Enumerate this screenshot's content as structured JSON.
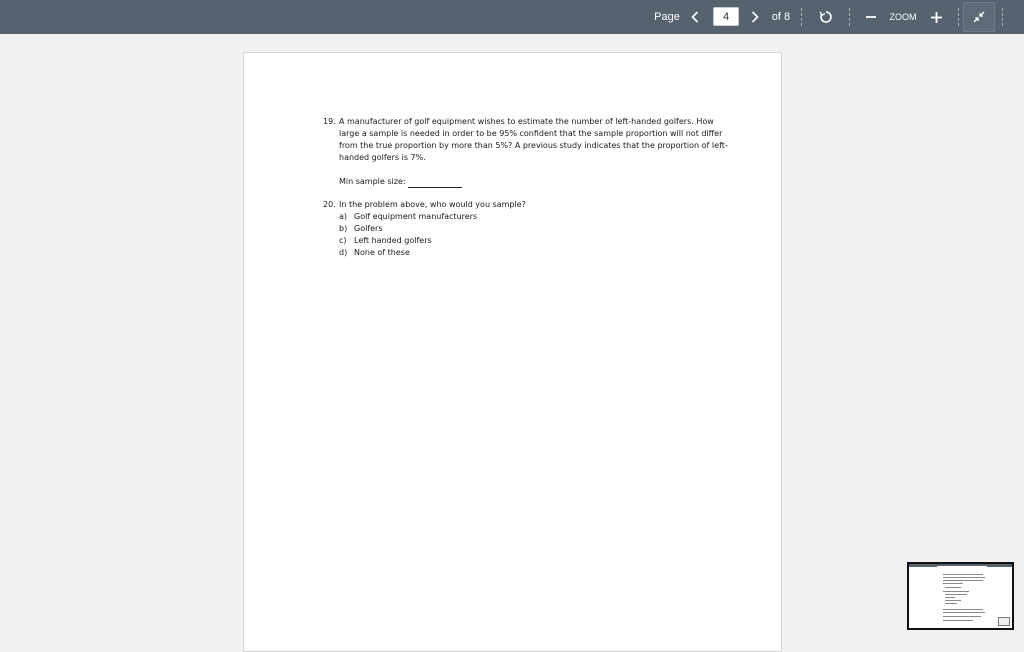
{
  "toolbar": {
    "page_label": "Page",
    "current_page": "4",
    "of_label": "of 8",
    "zoom_label": "ZOOM",
    "prev_icon": "chevron-left-icon",
    "next_icon": "chevron-right-icon",
    "rotate_icon": "rotate-icon",
    "zoom_out_icon": "minus-icon",
    "zoom_in_icon": "plus-icon",
    "fit_icon": "collapse-arrows-icon"
  },
  "document": {
    "q19": {
      "number": "19.",
      "text": "A manufacturer of golf equipment wishes to estimate the number of left-handed golfers. How large a sample is needed in order to be 95% confident that the sample proportion will not differ from the true proportion by more than 5%? A previous study indicates that the proportion of left-handed golfers is 7%.",
      "min_label": "Min sample size:"
    },
    "q20": {
      "number": "20.",
      "text": "In the problem above, who would you sample?",
      "options": [
        {
          "letter": "a)",
          "text": "Golf equipment manufacturers"
        },
        {
          "letter": "b)",
          "text": "Golfers"
        },
        {
          "letter": "c)",
          "text": "Left handed golfers"
        },
        {
          "letter": "d)",
          "text": "None of these"
        }
      ]
    }
  },
  "colors": {
    "toolbar_bg": "#56636f",
    "viewer_bg": "#f1f1f1"
  }
}
